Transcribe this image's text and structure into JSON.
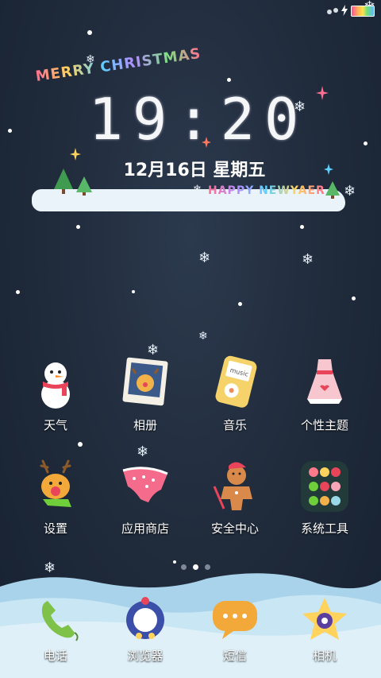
{
  "status_bar": {
    "icons": [
      "notification-dot-icon",
      "charging-icon",
      "battery-icon"
    ],
    "battery_color": "#ff4fa0"
  },
  "lockscreen": {
    "greeting": "MERRY CHRISTMAS",
    "time": "19:20",
    "date": "12月16日 星期五",
    "new_year_text": "HAPPY NEWYAER",
    "greeting_colors": [
      "#ff6f91",
      "#ffd35c",
      "#5fd0ff",
      "#b48cff",
      "#7ee081"
    ]
  },
  "apps": [
    {
      "label": "天气",
      "icon": "snowman-icon"
    },
    {
      "label": "相册",
      "icon": "photo-frame-icon"
    },
    {
      "label": "音乐",
      "icon": "music-player-icon"
    },
    {
      "label": "个性主题",
      "icon": "dress-icon"
    },
    {
      "label": "设置",
      "icon": "reindeer-icon"
    },
    {
      "label": "应用商店",
      "icon": "underwear-icon"
    },
    {
      "label": "安全中心",
      "icon": "gingerbread-icon"
    },
    {
      "label": "系统工具",
      "icon": "toolbox-icon"
    }
  ],
  "dock": [
    {
      "label": "电话",
      "icon": "phone-icon"
    },
    {
      "label": "浏览器",
      "icon": "wreath-icon"
    },
    {
      "label": "短信",
      "icon": "message-bubble-icon"
    },
    {
      "label": "相机",
      "icon": "star-camera-icon"
    }
  ],
  "page_indicator": {
    "pages": 3,
    "active": 1
  }
}
